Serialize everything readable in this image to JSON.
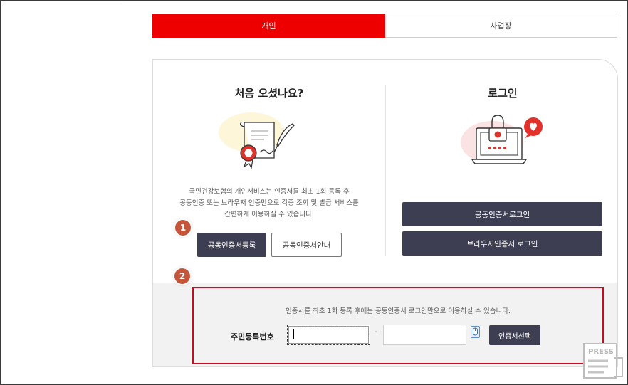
{
  "tabs": [
    {
      "label": "개인",
      "active": true
    },
    {
      "label": "사업장",
      "active": false
    }
  ],
  "welcome": {
    "title": "처음 오셨나요?",
    "description_lines": [
      "국민건강보험의 개인서비스는 인증서를 최초 1회 등록 후",
      "공동인증 또는 브라우저 인증만으로 각종 조회 및 발급 서비스를",
      "간편하게 이용하실 수 있습니다."
    ],
    "register_button": "공동인증서등록",
    "guide_button": "공동인증서안내",
    "step_marker": "1"
  },
  "login": {
    "title": "로그인",
    "joint_cert_button": "공동인증서로그인",
    "browser_cert_button": "브라우저인증서 로그인"
  },
  "registration": {
    "step_marker": "2",
    "notice": "인증서를 최초 1회 등록 후에는 공동인증서 로그인만으로 이용하실 수 있습니다.",
    "rrn_label": "주민등록번호",
    "rrn_first_value": "",
    "rrn_separator": "-",
    "rrn_second_value": "",
    "select_cert_button": "인증서선택"
  },
  "watermark": {
    "text": "PRESS"
  },
  "colors": {
    "accent_red": "#ee0000",
    "button_dark": "#3d3e52",
    "step_marker": "#c4553a",
    "highlight_border": "#c40d1f"
  },
  "icons": [
    "certificate-scroll-icon",
    "feather-pen-icon",
    "seal-ribbon-icon",
    "laptop-lock-icon",
    "heart-bubble-icon",
    "mouse-icon",
    "press-watermark-icon"
  ]
}
